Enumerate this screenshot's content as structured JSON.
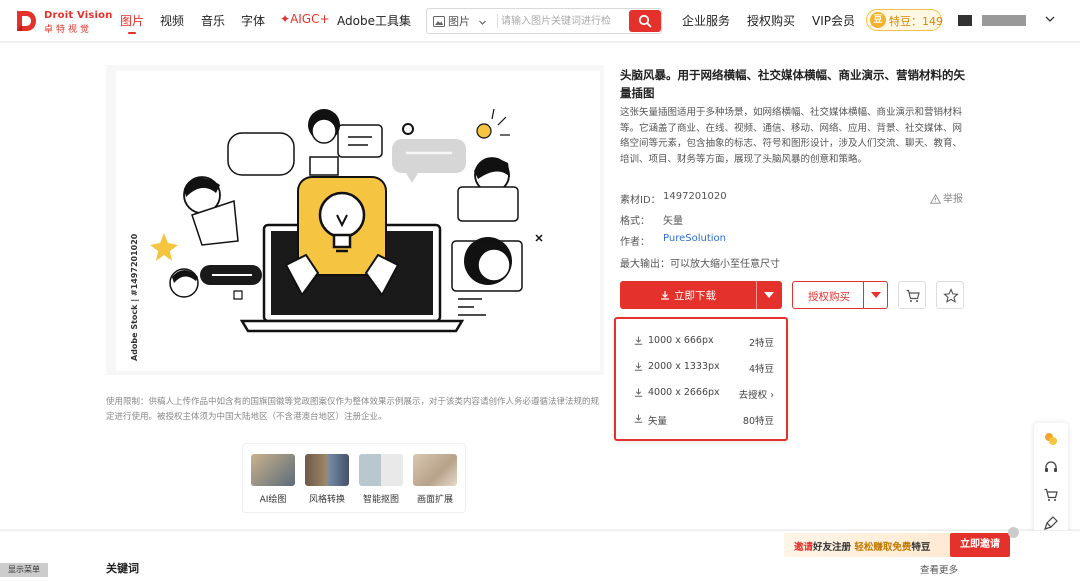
{
  "brand": {
    "name_en": "Droit Vision",
    "name_cn": "卓特视觉",
    "accent": "#e5312b"
  },
  "nav": {
    "items": [
      "图片",
      "视频",
      "音乐",
      "字体",
      "AIGC",
      "Adobe工具集"
    ],
    "active": "图片"
  },
  "search": {
    "type_label": "图片",
    "placeholder": "请输入图片关键词进行检"
  },
  "right_nav": {
    "enterprise": "企业服务",
    "license": "授权购买",
    "vip": "VIP会员",
    "beans": "特豆：149"
  },
  "asset": {
    "title": "头脑风暴。用于网络横幅、社交媒体横幅、商业演示、营销材料的矢量插图",
    "description": "这张矢量插图适用于多种场景，如网络横幅、社交媒体横幅、商业演示和营销材料等。它涵盖了商业、在线、视频、通信、移动、网络、应用、背景、社交媒体、网络空间等元素，包含抽象的标志、符号和图形设计，涉及人们交流、聊天、教育、培训、项目、财务等方面，展现了头脑风暴的创意和策略。",
    "id_label": "素材ID：",
    "id": "1497201020",
    "format_label": "格式：",
    "format": "矢量",
    "author_label": "作者：",
    "author": "PureSolution",
    "max_output_label": "最大输出：",
    "max_output": "可以放大缩小至任意尺寸",
    "report": "举报",
    "credit": "Adobe Stock | #1497201020"
  },
  "actions": {
    "download": "立即下载",
    "license": "授权购买"
  },
  "download_options": [
    {
      "size": "1000 x 666px",
      "price": "2特豆"
    },
    {
      "size": "2000 x 1333px",
      "price": "4特豆"
    },
    {
      "size": "4000 x 2666px",
      "price": "去授权"
    },
    {
      "size": "矢量",
      "price": "80特豆"
    }
  ],
  "usage_notice": "使用限制：供稿人上传作品中如含有的国旗国徽等党政图案仅作为整体效果示例展示，对于该类内容请创作人务必遵循法律法规的规定进行使用。被授权主体须为中国大陆地区（不含港澳台地区）注册企业。",
  "tools": [
    "AI绘图",
    "风格转换",
    "智能抠图",
    "画面扩展"
  ],
  "bottom": {
    "keywords": "关键词",
    "see_more": "查看更多",
    "show_menu": "显示菜单"
  },
  "promo": {
    "text_prefix": "邀请",
    "text_mid1": "好友注册 ",
    "text_highlight": "轻松赚取免费",
    "text_suffix": "特豆",
    "button": "立即邀请"
  }
}
